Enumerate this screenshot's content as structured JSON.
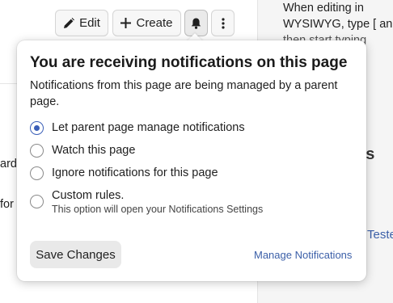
{
  "toolbar": {
    "edit_label": "Edit",
    "create_label": "Create",
    "edit_icon": "pencil-icon",
    "create_icon": "plus-icon",
    "notifications_icon": "bell-icon",
    "more_icon": "vertical-ellipsis-icon"
  },
  "background": {
    "hint_lines": [
      "When editing in",
      "WYSIWYG, type [ and",
      "then start typing"
    ],
    "side_heading": "ns",
    "side_link": "Teste",
    "left_text_1": "ard",
    "left_text_2": "for"
  },
  "popover": {
    "title": "You are receiving notifications on this page",
    "description": "Notifications from this page are being managed by a parent page.",
    "options": [
      {
        "label": "Let parent page manage notifications",
        "selected": true
      },
      {
        "label": "Watch this page",
        "selected": false
      },
      {
        "label": "Ignore notifications for this page",
        "selected": false
      },
      {
        "label": "Custom rules.",
        "sublabel": "This option will open your Notifications Settings",
        "selected": false
      }
    ],
    "save_label": "Save Changes",
    "manage_label": "Manage Notifications"
  },
  "colors": {
    "accent": "#3b5fb8",
    "link": "#3b5fa8",
    "button_bg": "#e9e9e9"
  }
}
